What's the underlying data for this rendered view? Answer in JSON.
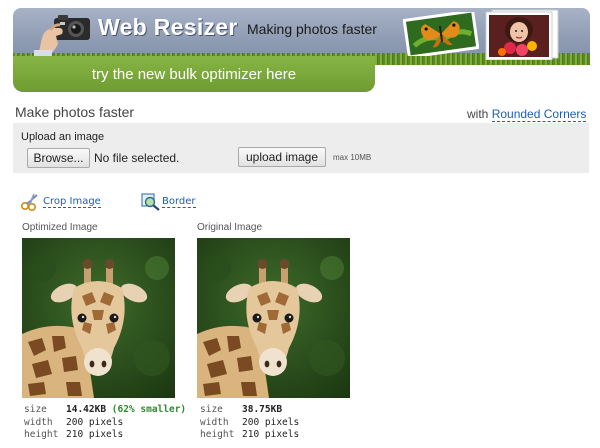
{
  "header": {
    "logo_text": "Web Resizer",
    "tagline": "Making photos faster",
    "bulk_button": "try the new bulk optimizer here"
  },
  "main": {
    "title": "Make photos faster",
    "with_text": "with",
    "rounded_link": "Rounded Corners"
  },
  "upload": {
    "label": "Upload an image",
    "browse_label": "Browse...",
    "file_status": "No file selected.",
    "upload_button": "upload image",
    "max_size": "max 10MB"
  },
  "tools": {
    "crop": "Crop Image",
    "border": "Border"
  },
  "optimized": {
    "caption": "Optimized Image",
    "size_label": "size",
    "size_value": "14.42KB",
    "size_note": "(62% smaller)",
    "width_label": "width",
    "width_value": "200 pixels",
    "height_label": "height",
    "height_value": "210 pixels"
  },
  "original": {
    "caption": "Original Image",
    "size_label": "size",
    "size_value": "38.75KB",
    "width_label": "width",
    "width_value": "200 pixels",
    "height_label": "height",
    "height_value": "210 pixels"
  },
  "colors": {
    "accent_green": "#7aa93b",
    "link_blue": "#1a5fb4",
    "savings_green": "#2e8b2e"
  }
}
